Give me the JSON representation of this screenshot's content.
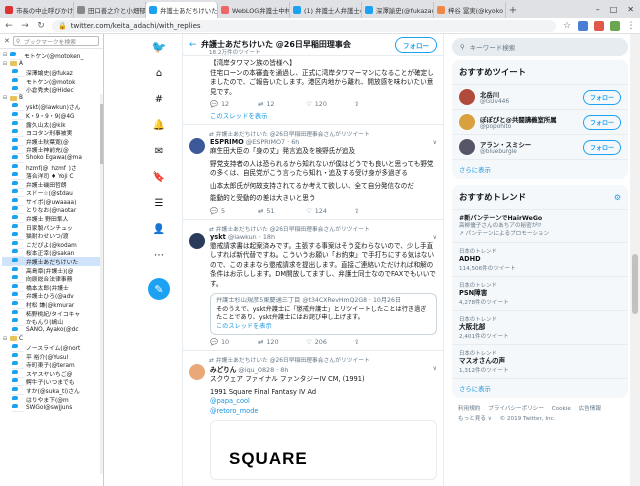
{
  "browser": {
    "tabs": [
      {
        "title": "市長の中止呼びかけ",
        "color": "#d33",
        "active": false
      },
      {
        "title": "田口善之介と小畑郁",
        "color": "#888",
        "active": false
      },
      {
        "title": "弁護士あだちけいた",
        "color": "#1da1f2",
        "active": true
      },
      {
        "title": "WebLOG弁護士中村",
        "color": "#e66",
        "active": false
      },
      {
        "title": "(1) 弁護士人弁護士の",
        "color": "#1da1f2",
        "active": false
      },
      {
        "title": "深澤諭史(@fukazaw",
        "color": "#1da1f2",
        "active": false
      },
      {
        "title": "梓谷 冨実(@kyoko",
        "color": "#e84",
        "active": false
      }
    ],
    "url": "twitter.com/keita_adachi/with_replies"
  },
  "bookmarks": {
    "search_placeholder": "ブックマークを検索",
    "items": [
      {
        "label": "モトケン(@motoken_",
        "type": "twitter",
        "level": 0,
        "expand": "⊟"
      },
      {
        "label": "A",
        "type": "folder",
        "level": 0,
        "expand": "⊟"
      },
      {
        "label": "深澤諭史(@fukaz",
        "type": "twitter",
        "level": 1
      },
      {
        "label": "モトケン(@motok",
        "type": "twitter",
        "level": 1
      },
      {
        "label": "小倉秀夫(@Hidec",
        "type": "twitter",
        "level": 1
      },
      {
        "label": "B",
        "type": "folder",
        "level": 0,
        "expand": "⊟"
      },
      {
        "label": "yskt(@lawkun)さん",
        "type": "twitter",
        "level": 1
      },
      {
        "label": "K・9・9・9(@4G",
        "type": "twitter",
        "level": 1
      },
      {
        "label": "露久山太(@kik",
        "type": "twitter",
        "level": 1
      },
      {
        "label": "ヨコタン刑事被実",
        "type": "twitter",
        "level": 1
      },
      {
        "label": "弁護士秋葉寛(@",
        "type": "twitter",
        "level": 1
      },
      {
        "label": "弁護士神前充(@",
        "type": "twitter",
        "level": 1
      },
      {
        "label": "Shoko Egawa(@ma",
        "type": "twitter",
        "level": 1
      },
      {
        "label": "hzmf(@_hzmf_)さ",
        "type": "twitter",
        "level": 1
      },
      {
        "label": "落合洋司 ♦ Yoji C",
        "type": "twitter",
        "level": 1
      },
      {
        "label": "弁護士磯田哲朗",
        "type": "twitter",
        "level": 1
      },
      {
        "label": "スドー☆(@stdau",
        "type": "twitter",
        "level": 1
      },
      {
        "label": "サイボ(@uwaaaa)",
        "type": "twitter",
        "level": 1
      },
      {
        "label": "とりなお(@naotar",
        "type": "twitter",
        "level": 1
      },
      {
        "label": "弁護士 野田隼人",
        "type": "twitter",
        "level": 1
      },
      {
        "label": "日家製パンチュッ",
        "type": "twitter",
        "level": 1
      },
      {
        "label": "猫耐わせいつ/渡",
        "type": "twitter",
        "level": 1
      },
      {
        "label": "こだぴよ(@kodam",
        "type": "twitter",
        "level": 1
      },
      {
        "label": "桜本正幸(@sakan",
        "type": "twitter",
        "level": 1
      },
      {
        "label": "弁護士あだちけいた",
        "type": "twitter",
        "level": 1,
        "selected": true
      },
      {
        "label": "高島章(弁護士)(@",
        "type": "twitter",
        "level": 1
      },
      {
        "label": "向原総合法律事務",
        "type": "twitter",
        "level": 1
      },
      {
        "label": "橋本太郎(弁護士",
        "type": "twitter",
        "level": 1
      },
      {
        "label": "弁護士ひろ(@adv",
        "type": "twitter",
        "level": 1
      },
      {
        "label": "村松 謙(@kmurar",
        "type": "twitter",
        "level": 1
      },
      {
        "label": "柘野桃紀/タイコキャ",
        "type": "twitter",
        "level": 1
      },
      {
        "label": "かもんり(嶋山",
        "type": "twitter",
        "level": 1
      },
      {
        "label": "SANO, Ayako(@dc",
        "type": "twitter",
        "level": 1
      },
      {
        "label": "C",
        "type": "folder",
        "level": 0,
        "expand": "⊟"
      },
      {
        "label": "ノースライム(@nort",
        "type": "twitter",
        "level": 1
      },
      {
        "label": "平 裕介(@Yusul",
        "type": "twitter",
        "level": 1
      },
      {
        "label": "寺町東子(@teram",
        "type": "twitter",
        "level": 1
      },
      {
        "label": "スヤスヤいちご@",
        "type": "twitter",
        "level": 1
      },
      {
        "label": "鰐牛子(いつまでも",
        "type": "twitter",
        "level": 1
      },
      {
        "label": "すか(@suka_ti)さん",
        "type": "twitter",
        "level": 1
      },
      {
        "label": "はりやま下(@m",
        "type": "twitter",
        "level": 1
      },
      {
        "label": "SWGol@swjjuns",
        "type": "twitter",
        "level": 1
      }
    ]
  },
  "nav": {
    "icons": [
      "twitter-bird-icon",
      "home-icon",
      "explore-icon",
      "notifications-icon",
      "messages-icon",
      "bookmarks-icon",
      "lists-icon",
      "profile-icon",
      "more-icon"
    ],
    "tweet_button": "✎"
  },
  "timeline": {
    "title": "弁護士あだちけいた @26日早稲田理事会",
    "count": "18.2万件のツイート",
    "follow_label": "フォロー",
    "tweet1": {
      "lines": [
        "【湾岸タワマン族の皆様へ】",
        "住宅ローンの本審査を通過し、正式に湾岸タワマーマンになることが確定しましたので、ご報告いたします。港区内地から離れ、開放感を味わいたい意見です。"
      ],
      "reply": "12",
      "retweet": "12",
      "like": "120",
      "show_thread": "このスレッドを表示"
    },
    "tweet2": {
      "retweeted_by": "弁護士あだちけいた @26日早稲田理事会さんがリツイート",
      "name": "ESPRIMO",
      "handle": "@ESPRIMO7 · 6h",
      "lines": [
        "麻生田大臣の「身の丈」発言追及を検野氏が追及",
        "野党支持者の人は恐られるから知れないが僕はどうでも良いと思っても野党の多くは、自民党がこう言ったら知れ・追及する受け身が多過ぎる",
        "山本太郎氏が何故支持されてるか考えて欲しい、全て自分発信なのだ",
        "能動的と受動的の差は大きいと思う"
      ],
      "reply": "5",
      "retweet": "51",
      "like": "124"
    },
    "tweet3": {
      "retweeted_by": "弁護士あだちけいた @26日早稲田理事会さんがリツイート",
      "name": "yskt",
      "handle": "@lawkun · 18h",
      "lines": [
        "懲戒請求書は起案済みです。主張する事案はそう変わらないので、少し手直しすれば新代替ですね。こういうお願い「お約束」で手打ちにする気はないので、このままなら懲戒請求を提出します。直接ご連絡いただければ和解の条件はお示しします。DM開放してますし、弁護士同士なのでFAXでもいいです。"
      ],
      "quote": {
        "header": "弁護士杉山規彦5東慶通三丁目 @t34CXRevHmQ2G8 · 10月26日",
        "text": "そのうえで、yskt弁護士に「懲戒弁護士」とリツイートしたことは行き過ぎたことであり、yskt弁護士にはお詫び申し上げます。",
        "link": "このスレッドを表示"
      },
      "reply": "10",
      "retweet": "120",
      "like": "206"
    },
    "tweet4": {
      "retweeted_by": "弁護士あだちけいた @26日早稲田理事会さんがリツイート",
      "name": "みどりん",
      "handle": "@iqu_0828 · 8h",
      "line1": "スクウェア ファイナル ファンタジーIV CM, (1991)",
      "line2": "1991 Square Final Fantasy IV Ad",
      "mention1": "@papa_cool",
      "mention2": "@retoro_mode",
      "image_text": "SQUARE"
    }
  },
  "sidebar": {
    "search_placeholder": "キーワード検索",
    "recommend_title": "おすすめツイート",
    "accounts": [
      {
        "name": "北岳川",
        "handle": "@GUv446",
        "follow": "フォロー",
        "color": "#b04a3a"
      },
      {
        "name": "ぽぽぴと@共闘講義室所属",
        "handle": "@popohito",
        "follow": "フォロー",
        "color": "#d9a040"
      },
      {
        "name": "アラン・スミシー",
        "handle": "@blueburgle",
        "follow": "フォロー",
        "color": "#556"
      }
    ],
    "more": "さらに表示",
    "trends_title": "おすすめトレンド",
    "trends": [
      {
        "ctx": "",
        "name": "#新パンテーンでHairWeGo",
        "count": "",
        "desc": "高柳優子さんのあちアの秘密が⁉"
      },
      {
        "ctx": "",
        "name": "",
        "count": "",
        "desc": "パンテーンによるプロモーション"
      },
      {
        "ctx": "日本のトレンド",
        "name": "ADHD",
        "count": "114,506件のツイート",
        "desc": ""
      },
      {
        "ctx": "日本のトレンド",
        "name": "PSN障害",
        "count": "4,278件のツイート",
        "desc": ""
      },
      {
        "ctx": "日本のトレンド",
        "name": "大阪北部",
        "count": "2,401件のツイート",
        "desc": ""
      },
      {
        "ctx": "日本のトレンド",
        "name": "マスオさんの声",
        "count": "1,312件のツイート",
        "desc": ""
      }
    ],
    "trends_more": "さらに表示",
    "footer": [
      "利用規約",
      "プライバシーポリシー",
      "Cookie",
      "広告情報",
      "もっと見る ∨",
      "© 2019 Twitter, Inc."
    ]
  }
}
